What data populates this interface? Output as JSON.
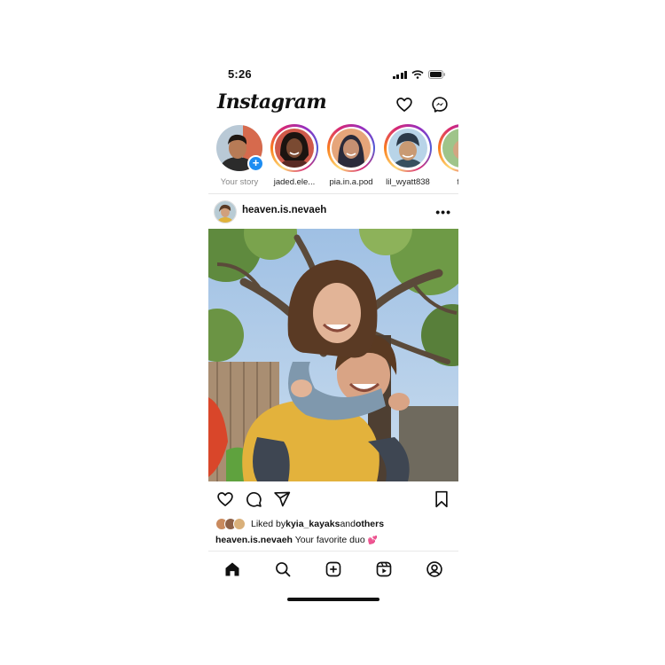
{
  "status_bar": {
    "time": "5:26"
  },
  "header": {
    "logo": "Instagram",
    "icons": [
      "heart-icon",
      "messenger-icon"
    ]
  },
  "stories": [
    {
      "label": "Your story",
      "own": true
    },
    {
      "label": "jaded.ele..."
    },
    {
      "label": "pia.in.a.pod"
    },
    {
      "label": "lil_wyatt838"
    },
    {
      "label": "fre"
    }
  ],
  "post": {
    "username": "heaven.is.nevaeh",
    "more": "•••",
    "likes": {
      "prefix": "Liked by ",
      "user": "kyia_kayaks",
      "middle": " and ",
      "others": "others"
    },
    "caption": {
      "username": "heaven.is.nevaeh",
      "text": " Your favorite duo ",
      "emoji": "💕"
    }
  },
  "bottom_nav": [
    "home-icon",
    "search-icon",
    "new-post-icon",
    "reels-icon",
    "profile-icon"
  ],
  "colors": {
    "accent_blue": "#1d8df2",
    "story_gradient": [
      "#feda75",
      "#fa7e1e",
      "#d62976",
      "#962fbf",
      "#4f5bd5"
    ]
  }
}
